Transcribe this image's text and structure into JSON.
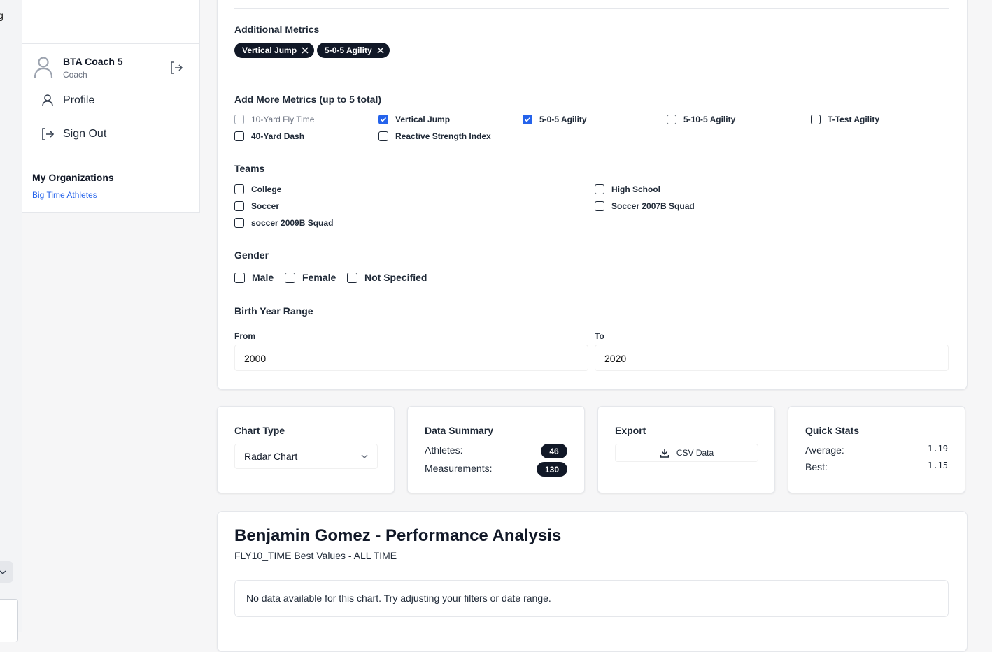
{
  "sidebar": {
    "cut_letter": "g",
    "user": {
      "name": "BTA Coach 5",
      "role": "Coach"
    },
    "menu": [
      {
        "label": "Profile",
        "icon": "user-icon"
      },
      {
        "label": "Sign Out",
        "icon": "sign-out-icon"
      }
    ],
    "organizations": {
      "title": "My Organizations",
      "items": [
        "Big Time Athletes"
      ]
    }
  },
  "filters": {
    "additional_metrics": {
      "title": "Additional Metrics",
      "chips": [
        "Vertical Jump",
        "5-0-5 Agility"
      ]
    },
    "add_metrics": {
      "title": "Add More Metrics (up to 5 total)",
      "options": [
        {
          "label": "10-Yard Fly Time",
          "checked": false,
          "disabled": true
        },
        {
          "label": "Vertical Jump",
          "checked": true
        },
        {
          "label": "5-0-5 Agility",
          "checked": true
        },
        {
          "label": "5-10-5 Agility",
          "checked": false
        },
        {
          "label": "T-Test Agility",
          "checked": false
        },
        {
          "label": "40-Yard Dash",
          "checked": false
        },
        {
          "label": "Reactive Strength Index",
          "checked": false
        }
      ]
    },
    "teams": {
      "title": "Teams",
      "options": [
        "College",
        "High School",
        "Soccer",
        "Soccer 2007B Squad",
        "soccer 2009B Squad"
      ]
    },
    "gender": {
      "title": "Gender",
      "options": [
        "Male",
        "Female",
        "Not Specified"
      ]
    },
    "birth_year": {
      "title": "Birth Year Range",
      "from_label": "From",
      "from_value": "2000",
      "to_label": "To",
      "to_value": "2020"
    }
  },
  "chart_type": {
    "title": "Chart Type",
    "value": "Radar Chart"
  },
  "data_summary": {
    "title": "Data Summary",
    "athletes_label": "Athletes:",
    "athletes_value": "46",
    "measurements_label": "Measurements:",
    "measurements_value": "130"
  },
  "export": {
    "title": "Export",
    "button": "CSV Data"
  },
  "quick_stats": {
    "title": "Quick Stats",
    "average_label": "Average:",
    "average_value": "1.19",
    "best_label": "Best:",
    "best_value": "1.15"
  },
  "analysis": {
    "title": "Benjamin Gomez - Performance Analysis",
    "subtitle": "FLY10_TIME Best Values - ALL TIME",
    "empty_message": "No data available for this chart. Try adjusting your filters or date range."
  },
  "colors": {
    "accent": "#2563eb",
    "badge": "#111827",
    "link": "#2563eb"
  }
}
